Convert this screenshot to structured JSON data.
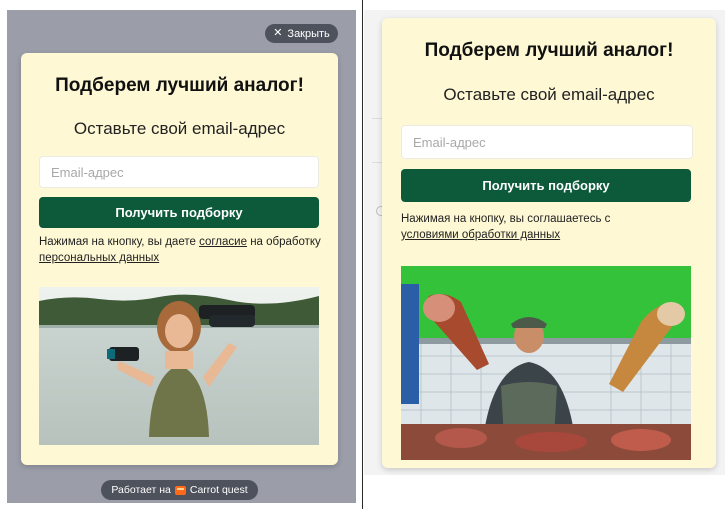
{
  "left_widget": {
    "close_label": "Закрыть",
    "title": "Подберем лучший аналог!",
    "subtitle": "Оставьте свой email-адрес",
    "email_placeholder": "Email-адрес",
    "submit_label": "Получить подборку",
    "consent_prefix": "Нажимая на кнопку, вы даете",
    "consent_link1": "согласие",
    "consent_middle": "на обработку",
    "consent_link2": "персональных данных",
    "powered_prefix": "Работает на",
    "powered_brand": "Carrot quest",
    "overlay_color": "#9b9ea9",
    "card_color": "#fef9d4",
    "button_color": "#0c5a3a"
  },
  "right_widget": {
    "title": "Подберем лучший аналог!",
    "subtitle": "Оставьте свой email-адрес",
    "email_placeholder": "Email-адрес",
    "submit_label": "Получить подборку",
    "consent_prefix": "Нажимая на кнопку, вы соглашаетесь с",
    "consent_link": "условиями обработки данных",
    "card_color": "#fef9d4",
    "button_color": "#0c5a3a"
  },
  "icons": {
    "close": "close-icon",
    "brand": "carrot-quest-logo-icon"
  }
}
